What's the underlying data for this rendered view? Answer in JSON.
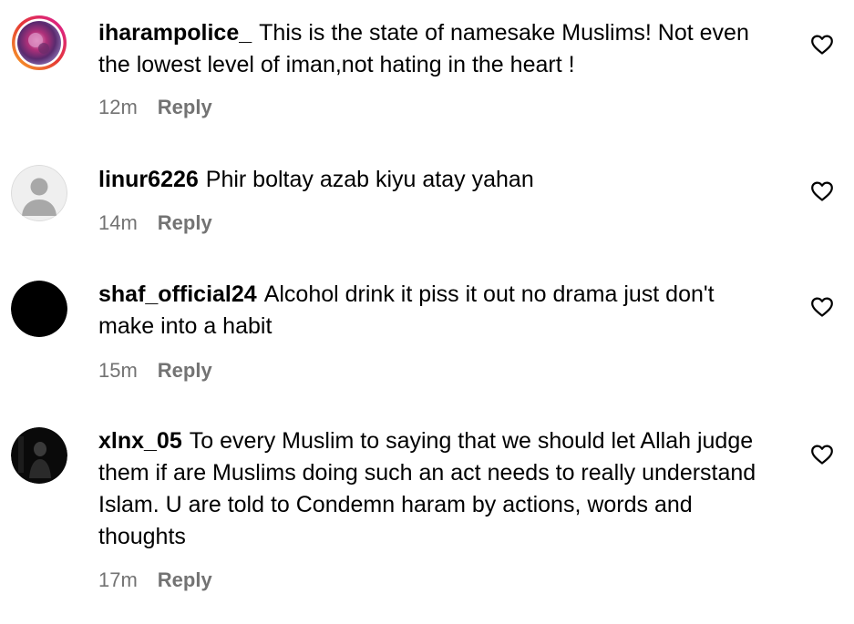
{
  "comments": [
    {
      "username": "iharampolice_",
      "text": "This is the state of namesake Muslims! Not even the lowest level of iman,not hating in the heart !",
      "time": "12m",
      "reply_label": "Reply",
      "avatar_icon": "profile-photo-story-ring"
    },
    {
      "username": "linur6226",
      "text": "Phir boltay azab kiyu atay yahan",
      "time": "14m",
      "reply_label": "Reply",
      "avatar_icon": "default-user-avatar"
    },
    {
      "username": "shaf_official24",
      "text": "Alcohol drink it piss it out no drama just don't make into a habit",
      "time": "15m",
      "reply_label": "Reply",
      "avatar_icon": "black-avatar"
    },
    {
      "username": "xlnx_05",
      "text": "To every Muslim to saying that we should let Allah judge them if are Muslims doing such an act needs to really understand Islam. U are told to Condemn haram by actions, words and thoughts",
      "time": "17m",
      "reply_label": "Reply",
      "avatar_icon": "dark-photo-avatar"
    }
  ],
  "like_icon": "heart-outline-icon",
  "colors": {
    "text": "#000000",
    "meta": "#737373",
    "story_ring_start": "#f9a825",
    "story_ring_end": "#d81b9c"
  }
}
